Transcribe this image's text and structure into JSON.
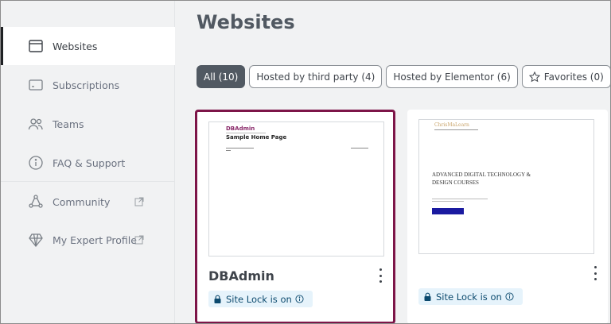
{
  "sidebar": {
    "items": [
      {
        "label": "Websites",
        "icon": "browser-window-icon",
        "active": true
      },
      {
        "label": "Subscriptions",
        "icon": "credit-card-icon"
      },
      {
        "label": "Teams",
        "icon": "users-icon"
      },
      {
        "label": "FAQ & Support",
        "icon": "info-circle-icon"
      },
      {
        "label": "Community",
        "icon": "community-icon",
        "external": true
      },
      {
        "label": "My Expert Profile",
        "icon": "diamond-icon",
        "external": true
      }
    ]
  },
  "main": {
    "title": "Websites",
    "filters": [
      {
        "label": "All (10)",
        "active": true
      },
      {
        "label": "Hosted by third party (4)"
      },
      {
        "label": "Hosted by Elementor (6)"
      },
      {
        "label": "Favorites (0)",
        "icon": "star-icon"
      }
    ],
    "cards": [
      {
        "name": "DBAdmin",
        "badge": "Site Lock is on",
        "selected": true,
        "thumbnail": {
          "brand": "DBAdmin",
          "title": "Sample Home Page"
        }
      },
      {
        "name": "",
        "badge": "Site Lock is on",
        "selected": false,
        "thumbnail": {
          "brand": "ChrisMaLearn",
          "heading": "ADVANCED DIGITAL TECHNOLOGY & DESIGN COURSES"
        }
      }
    ]
  },
  "colors": {
    "accent": "#7d1548",
    "active_chip": "#515962",
    "badge_bg": "#e6f3fb",
    "cta": "#1a1aa0"
  }
}
